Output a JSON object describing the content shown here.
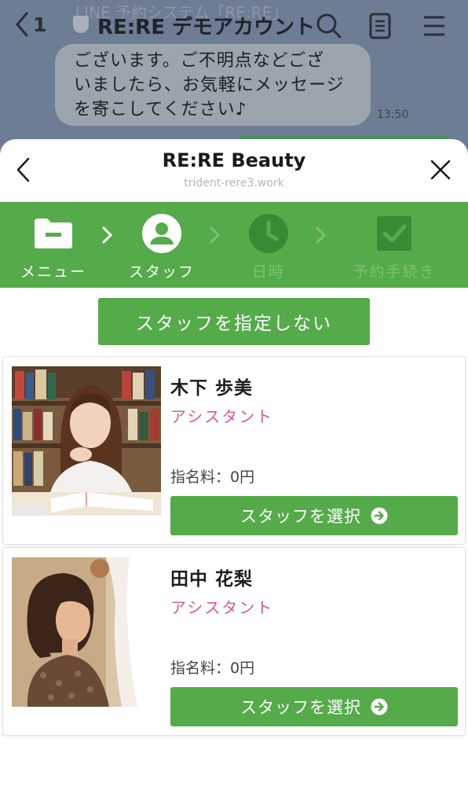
{
  "chat": {
    "back_count": "1",
    "title": "RE:RE デモアカウント",
    "overflow_text": "LINE 予約システム「RE:RE」",
    "message": "ございます。ご不明点などござ\nいましたら、お気軽にメッセージ\nを寄こしてください♪",
    "time": "13:50"
  },
  "sheet": {
    "title": "RE:RE Beauty",
    "url": "trident-rere3.work"
  },
  "steps": [
    {
      "label": "メニュー",
      "icon": "folder-icon"
    },
    {
      "label": "スタッフ",
      "icon": "user-icon"
    },
    {
      "label": "日時",
      "icon": "clock-icon"
    },
    {
      "label": "予約手続き",
      "icon": "checkbox-icon"
    }
  ],
  "no_staff_button": "スタッフを指定しない",
  "staff": [
    {
      "name": "木下 歩美",
      "role": "アシスタント",
      "fee": "指名料：0円",
      "button": "スタッフを選択"
    },
    {
      "name": "田中 花梨",
      "role": "アシスタント",
      "fee": "指名料：0円",
      "button": "スタッフを選択"
    }
  ],
  "colors": {
    "accent": "#55ab4a",
    "role": "#d25a94"
  }
}
